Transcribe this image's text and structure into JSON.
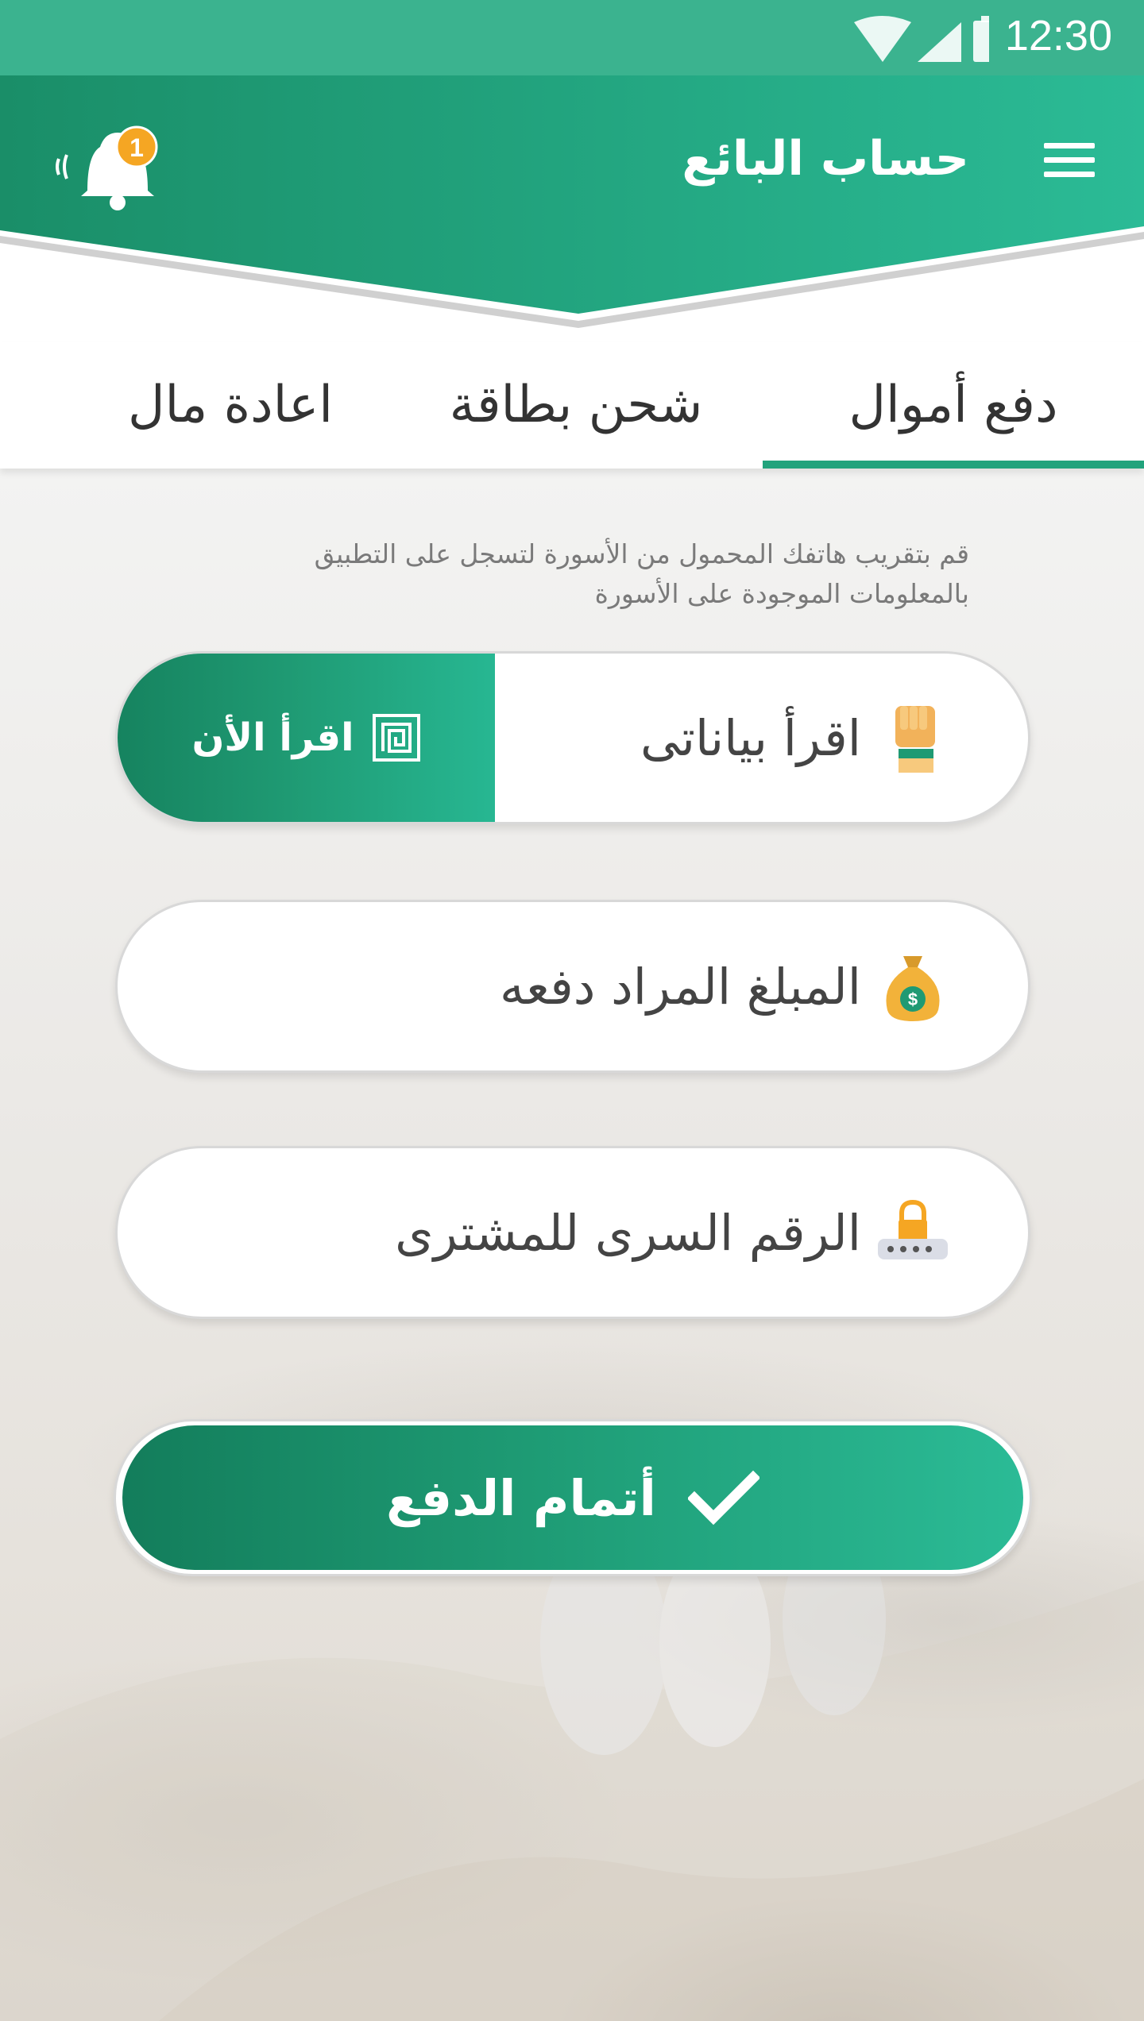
{
  "status_bar": {
    "time": "12:30",
    "icons": [
      "wifi-icon",
      "signal-icon",
      "battery-icon"
    ]
  },
  "header": {
    "title": "حساب البائع",
    "notification_count": "1",
    "menu_icon": "hamburger-menu-icon",
    "bell_icon": "bell-icon"
  },
  "tabs": [
    {
      "label": "دفع أموال",
      "active": true
    },
    {
      "label": "شحن بطاقة",
      "active": false
    },
    {
      "label": "اعادة مال",
      "active": false
    }
  ],
  "hint": {
    "line1": "قم بتقريب هاتفك المحمول  من الأسورة لتسجل على  التطبيق",
    "line2": "بالمعلومات الموجودة على الأسورة"
  },
  "fields": {
    "read_data": {
      "label": "اقرأ بياناتى",
      "icon": "wristband-hand-icon"
    },
    "read_now": {
      "label": "اقرأ الأن",
      "icon": "nfc-icon"
    },
    "amount": {
      "label": "المبلغ المراد دفعه",
      "icon": "money-bag-icon"
    },
    "pin": {
      "label": "الرقم السرى للمشترى",
      "icon": "lock-password-icon"
    }
  },
  "submit": {
    "label": "أتمام الدفع",
    "icon": "checkmark-icon"
  },
  "colors": {
    "primary": "#22a37c",
    "primary_dark": "#137d5b",
    "primary_light": "#2bbb96",
    "status_bar": "#3bb38f",
    "badge": "#f5a623"
  }
}
